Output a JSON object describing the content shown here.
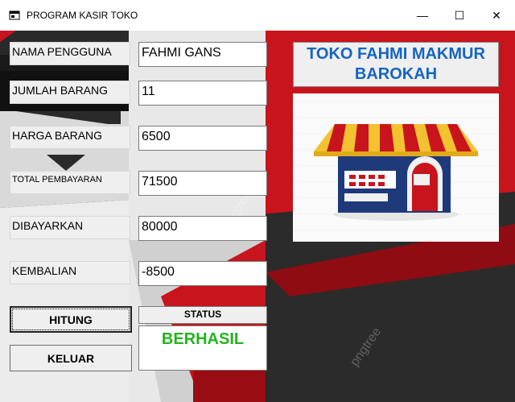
{
  "window": {
    "title": "PROGRAM KASIR TOKO",
    "minimize_glyph": "—",
    "maximize_glyph": "☐",
    "close_glyph": "✕",
    "icon": "app-window-icon"
  },
  "form": {
    "nama_pengguna": {
      "label": "NAMA PENGGUNA",
      "value": "FAHMI GANS"
    },
    "jumlah_barang": {
      "label": "JUMLAH BARANG",
      "value": "11"
    },
    "harga_barang": {
      "label": "HARGA BARANG",
      "value": "6500"
    },
    "total_pembayaran": {
      "label": "TOTAL PEMBAYARAN",
      "value": "71500"
    },
    "dibayarkan": {
      "label": "DIBAYARKAN",
      "value": "80000"
    },
    "kembalian": {
      "label": "KEMBALIAN",
      "value": "-8500"
    }
  },
  "buttons": {
    "hitung": "HITUNG",
    "keluar": "KELUAR"
  },
  "status": {
    "label": "STATUS",
    "value": "BERHASIL",
    "color": "#22b51c"
  },
  "store": {
    "name": "TOKO FAHMI MAKMUR BAROKAH",
    "name_color": "#1565c0",
    "image": "shop-storefront-illustration"
  },
  "colors": {
    "accent_red": "#c8141c",
    "dark_bg": "#2b2b2b"
  }
}
